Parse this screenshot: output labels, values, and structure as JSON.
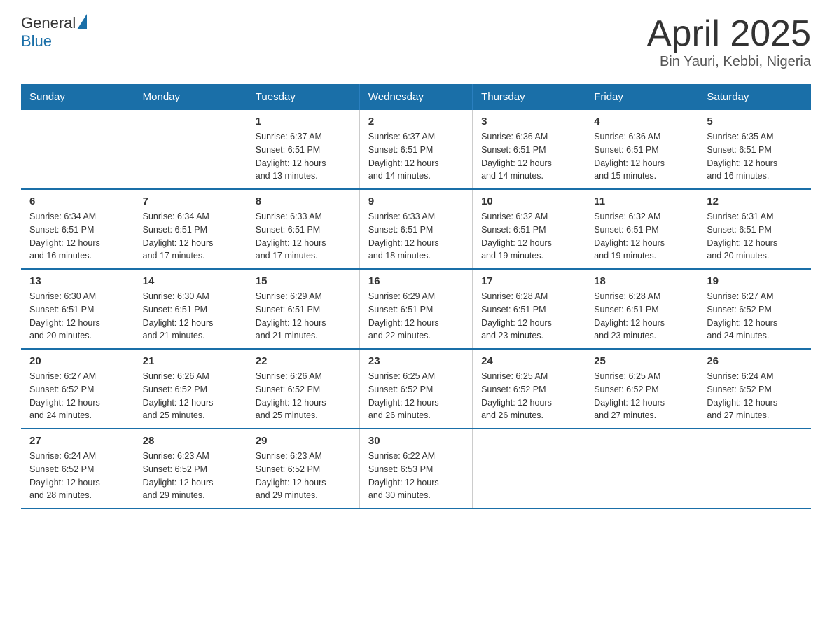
{
  "logo": {
    "general": "General",
    "blue": "Blue"
  },
  "title": "April 2025",
  "subtitle": "Bin Yauri, Kebbi, Nigeria",
  "days_of_week": [
    "Sunday",
    "Monday",
    "Tuesday",
    "Wednesday",
    "Thursday",
    "Friday",
    "Saturday"
  ],
  "weeks": [
    [
      {
        "day": "",
        "info": ""
      },
      {
        "day": "",
        "info": ""
      },
      {
        "day": "1",
        "info": "Sunrise: 6:37 AM\nSunset: 6:51 PM\nDaylight: 12 hours\nand 13 minutes."
      },
      {
        "day": "2",
        "info": "Sunrise: 6:37 AM\nSunset: 6:51 PM\nDaylight: 12 hours\nand 14 minutes."
      },
      {
        "day": "3",
        "info": "Sunrise: 6:36 AM\nSunset: 6:51 PM\nDaylight: 12 hours\nand 14 minutes."
      },
      {
        "day": "4",
        "info": "Sunrise: 6:36 AM\nSunset: 6:51 PM\nDaylight: 12 hours\nand 15 minutes."
      },
      {
        "day": "5",
        "info": "Sunrise: 6:35 AM\nSunset: 6:51 PM\nDaylight: 12 hours\nand 16 minutes."
      }
    ],
    [
      {
        "day": "6",
        "info": "Sunrise: 6:34 AM\nSunset: 6:51 PM\nDaylight: 12 hours\nand 16 minutes."
      },
      {
        "day": "7",
        "info": "Sunrise: 6:34 AM\nSunset: 6:51 PM\nDaylight: 12 hours\nand 17 minutes."
      },
      {
        "day": "8",
        "info": "Sunrise: 6:33 AM\nSunset: 6:51 PM\nDaylight: 12 hours\nand 17 minutes."
      },
      {
        "day": "9",
        "info": "Sunrise: 6:33 AM\nSunset: 6:51 PM\nDaylight: 12 hours\nand 18 minutes."
      },
      {
        "day": "10",
        "info": "Sunrise: 6:32 AM\nSunset: 6:51 PM\nDaylight: 12 hours\nand 19 minutes."
      },
      {
        "day": "11",
        "info": "Sunrise: 6:32 AM\nSunset: 6:51 PM\nDaylight: 12 hours\nand 19 minutes."
      },
      {
        "day": "12",
        "info": "Sunrise: 6:31 AM\nSunset: 6:51 PM\nDaylight: 12 hours\nand 20 minutes."
      }
    ],
    [
      {
        "day": "13",
        "info": "Sunrise: 6:30 AM\nSunset: 6:51 PM\nDaylight: 12 hours\nand 20 minutes."
      },
      {
        "day": "14",
        "info": "Sunrise: 6:30 AM\nSunset: 6:51 PM\nDaylight: 12 hours\nand 21 minutes."
      },
      {
        "day": "15",
        "info": "Sunrise: 6:29 AM\nSunset: 6:51 PM\nDaylight: 12 hours\nand 21 minutes."
      },
      {
        "day": "16",
        "info": "Sunrise: 6:29 AM\nSunset: 6:51 PM\nDaylight: 12 hours\nand 22 minutes."
      },
      {
        "day": "17",
        "info": "Sunrise: 6:28 AM\nSunset: 6:51 PM\nDaylight: 12 hours\nand 23 minutes."
      },
      {
        "day": "18",
        "info": "Sunrise: 6:28 AM\nSunset: 6:51 PM\nDaylight: 12 hours\nand 23 minutes."
      },
      {
        "day": "19",
        "info": "Sunrise: 6:27 AM\nSunset: 6:52 PM\nDaylight: 12 hours\nand 24 minutes."
      }
    ],
    [
      {
        "day": "20",
        "info": "Sunrise: 6:27 AM\nSunset: 6:52 PM\nDaylight: 12 hours\nand 24 minutes."
      },
      {
        "day": "21",
        "info": "Sunrise: 6:26 AM\nSunset: 6:52 PM\nDaylight: 12 hours\nand 25 minutes."
      },
      {
        "day": "22",
        "info": "Sunrise: 6:26 AM\nSunset: 6:52 PM\nDaylight: 12 hours\nand 25 minutes."
      },
      {
        "day": "23",
        "info": "Sunrise: 6:25 AM\nSunset: 6:52 PM\nDaylight: 12 hours\nand 26 minutes."
      },
      {
        "day": "24",
        "info": "Sunrise: 6:25 AM\nSunset: 6:52 PM\nDaylight: 12 hours\nand 26 minutes."
      },
      {
        "day": "25",
        "info": "Sunrise: 6:25 AM\nSunset: 6:52 PM\nDaylight: 12 hours\nand 27 minutes."
      },
      {
        "day": "26",
        "info": "Sunrise: 6:24 AM\nSunset: 6:52 PM\nDaylight: 12 hours\nand 27 minutes."
      }
    ],
    [
      {
        "day": "27",
        "info": "Sunrise: 6:24 AM\nSunset: 6:52 PM\nDaylight: 12 hours\nand 28 minutes."
      },
      {
        "day": "28",
        "info": "Sunrise: 6:23 AM\nSunset: 6:52 PM\nDaylight: 12 hours\nand 29 minutes."
      },
      {
        "day": "29",
        "info": "Sunrise: 6:23 AM\nSunset: 6:52 PM\nDaylight: 12 hours\nand 29 minutes."
      },
      {
        "day": "30",
        "info": "Sunrise: 6:22 AM\nSunset: 6:53 PM\nDaylight: 12 hours\nand 30 minutes."
      },
      {
        "day": "",
        "info": ""
      },
      {
        "day": "",
        "info": ""
      },
      {
        "day": "",
        "info": ""
      }
    ]
  ]
}
